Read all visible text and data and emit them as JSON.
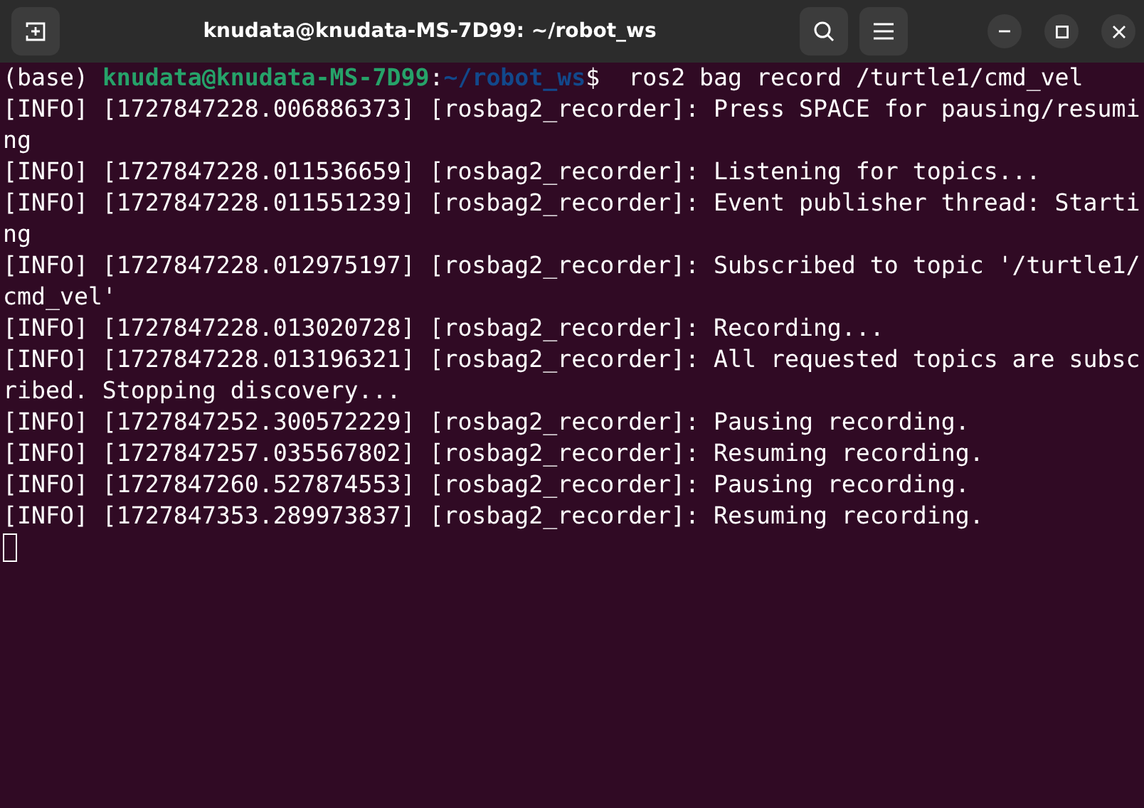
{
  "window": {
    "title": "knudata@knudata-MS-7D99: ~/robot_ws"
  },
  "terminal": {
    "prompt": [
      {
        "kind": "plain",
        "text": "(base) "
      },
      {
        "kind": "user",
        "text": "knudata@knudata-MS-7D99"
      },
      {
        "kind": "plain",
        "text": ":"
      },
      {
        "kind": "path",
        "text": "~/robot_ws"
      },
      {
        "kind": "plain",
        "text": "$  ros2 bag record /turtle1/cmd_vel"
      }
    ],
    "lines": [
      "[INFO] [1727847228.006886373] [rosbag2_recorder]: Press SPACE for pausing/resuming",
      "[INFO] [1727847228.011536659] [rosbag2_recorder]: Listening for topics...",
      "[INFO] [1727847228.011551239] [rosbag2_recorder]: Event publisher thread: Starting",
      "[INFO] [1727847228.012975197] [rosbag2_recorder]: Subscribed to topic '/turtle1/cmd_vel'",
      "[INFO] [1727847228.013020728] [rosbag2_recorder]: Recording...",
      "[INFO] [1727847228.013196321] [rosbag2_recorder]: All requested topics are subscribed. Stopping discovery...",
      "[INFO] [1727847252.300572229] [rosbag2_recorder]: Pausing recording.",
      "[INFO] [1727847257.035567802] [rosbag2_recorder]: Resuming recording.",
      "[INFO] [1727847260.527874553] [rosbag2_recorder]: Pausing recording.",
      "[INFO] [1727847353.289973837] [rosbag2_recorder]: Resuming recording."
    ]
  }
}
